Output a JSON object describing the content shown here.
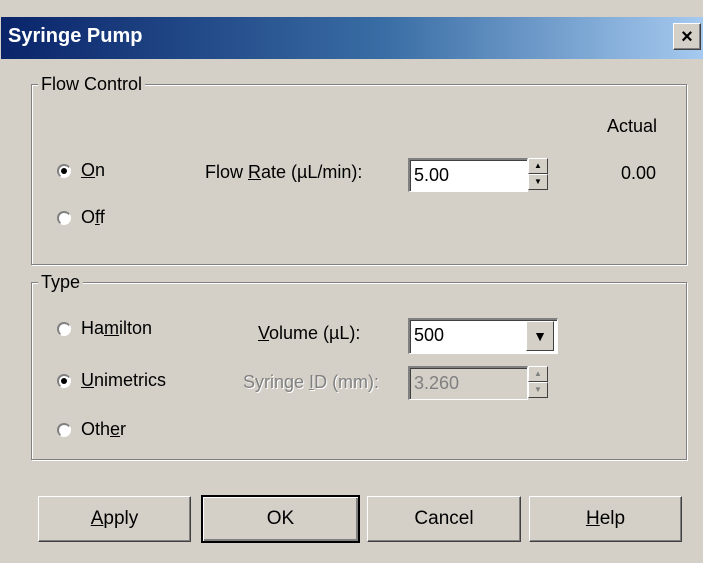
{
  "window": {
    "title": "Syringe Pump",
    "close_glyph": "×"
  },
  "flow_control": {
    "group_title": "Flow Control",
    "actual_header": "Actual",
    "on": {
      "pre": "",
      "mn": "O",
      "post": "n",
      "checked": true
    },
    "off": {
      "pre": "O",
      "mn": "f",
      "post": "f",
      "checked": false
    },
    "flow_rate_label": {
      "pre": "Flow ",
      "mn": "R",
      "post": "ate (µL/min):"
    },
    "flow_rate_value": "5.00",
    "actual_value": "0.00"
  },
  "type": {
    "group_title": "Type",
    "hamilton": {
      "pre": "Ha",
      "mn": "m",
      "post": "ilton",
      "checked": false
    },
    "unimetrics": {
      "pre": "",
      "mn": "U",
      "post": "nimetrics",
      "checked": true
    },
    "other": {
      "pre": "Oth",
      "mn": "e",
      "post": "r",
      "checked": false
    },
    "volume_label": {
      "pre": "",
      "mn": "V",
      "post": "olume (µL):"
    },
    "volume_value": "500",
    "syringe_id_label": {
      "pre": "Syringe ",
      "mn": "I",
      "post": "D (mm):"
    },
    "syringe_id_value": "3.260"
  },
  "buttons": {
    "apply": {
      "pre": "",
      "mn": "A",
      "post": "pply"
    },
    "ok": "OK",
    "cancel": "Cancel",
    "help": {
      "pre": "",
      "mn": "H",
      "post": "elp"
    }
  },
  "icons": {
    "spin_up": "▲",
    "spin_down": "▼",
    "dropdown": "▼"
  }
}
